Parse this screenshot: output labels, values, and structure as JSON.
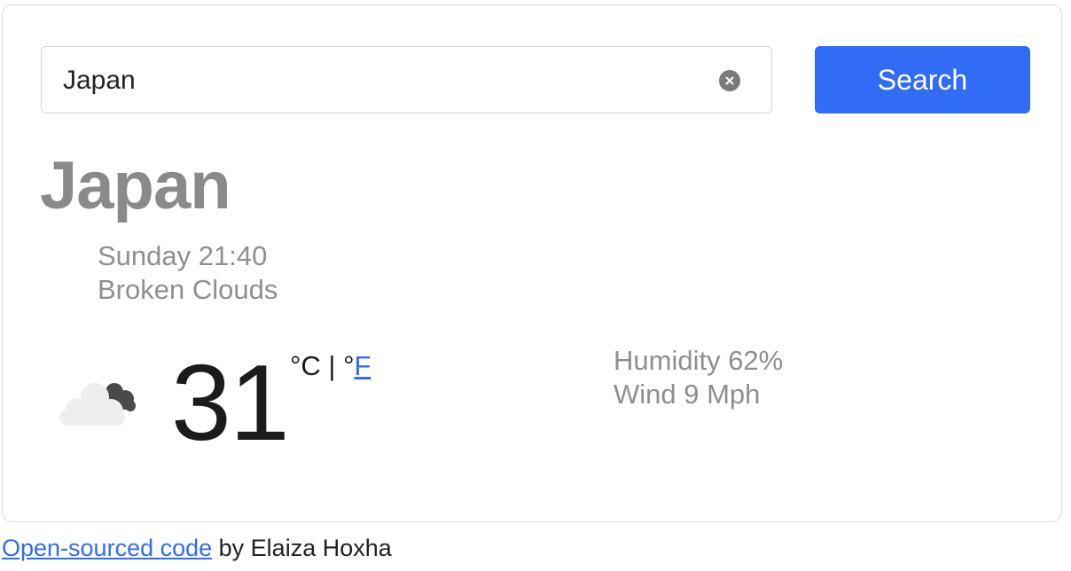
{
  "search": {
    "value": "Japan",
    "button_label": "Search"
  },
  "weather": {
    "city": "Japan",
    "date": "Sunday 21:40",
    "description": "Broken Clouds",
    "icon": "broken-clouds-icon",
    "temperature": "31",
    "unit_celsius": "°C",
    "unit_separator": " | ",
    "unit_fahrenheit_prefix": "°",
    "unit_fahrenheit_link": "F",
    "humidity": "Humidity 62%",
    "wind": "Wind 9 Mph"
  },
  "footer": {
    "link_text": "Open-sourced code",
    "author_text": " by Elaiza Hoxha"
  },
  "colors": {
    "accent": "#306cf5",
    "muted_text": "#8f8f8f",
    "city_text": "#8a8a8a"
  }
}
